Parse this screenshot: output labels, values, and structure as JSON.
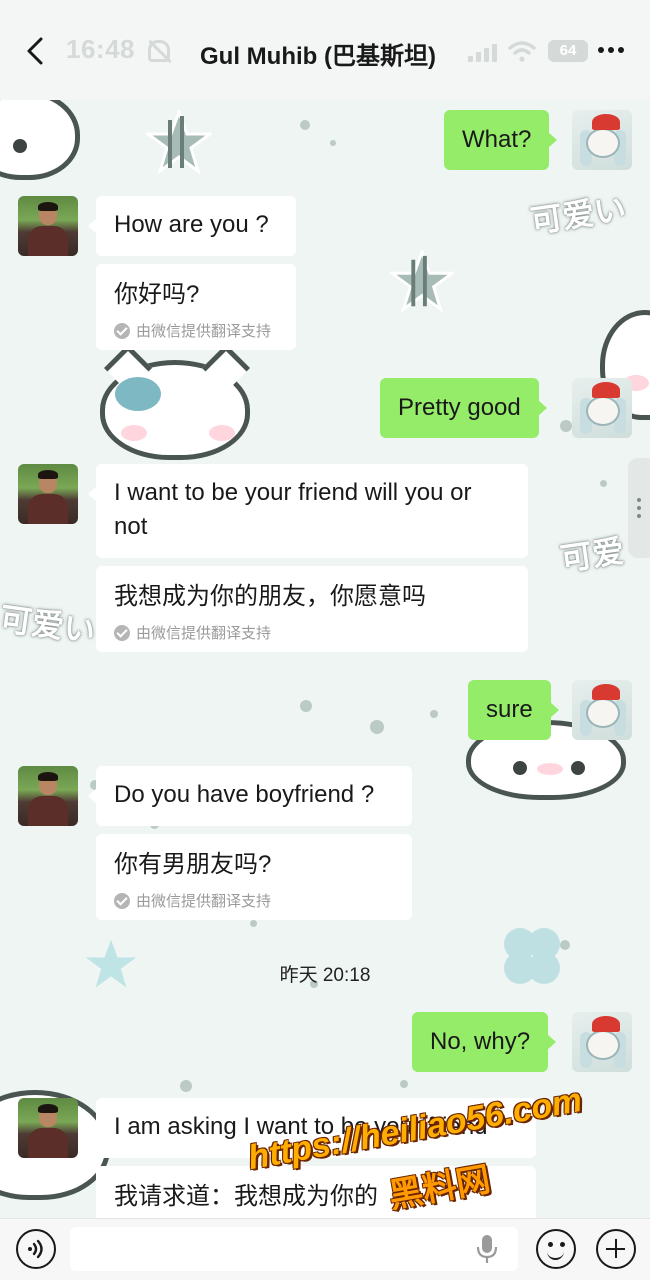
{
  "status_bar": {
    "time": "16:48",
    "battery": "64"
  },
  "header": {
    "title": "Gul Muhib (巴基斯坦)"
  },
  "background": {
    "sticker_text_1": "可爱い",
    "sticker_text_2": "可爱",
    "sticker_text_3": "可爱い"
  },
  "messages": [
    {
      "side": "me",
      "text": "What?"
    },
    {
      "side": "friend",
      "text": "How are you ?",
      "translation": "你好吗?",
      "translation_note": "由微信提供翻译支持"
    },
    {
      "side": "me",
      "text": "Pretty good"
    },
    {
      "side": "friend",
      "text": "I want to be your friend will you or not",
      "translation": "我想成为你的朋友，你愿意吗",
      "translation_note": "由微信提供翻译支持"
    },
    {
      "side": "me",
      "text": "sure"
    },
    {
      "side": "friend",
      "text": "Do you have boyfriend ?",
      "translation": "你有男朋友吗?",
      "translation_note": "由微信提供翻译支持"
    },
    {
      "side": "me",
      "text": "No, why?"
    },
    {
      "side": "friend",
      "text": "I am asking I want to be your friend",
      "translation": "我请求道：我想成为你的"
    }
  ],
  "timestamp": "昨天 20:18",
  "watermark": {
    "url": "https://heiliao56.com",
    "name": "黑料网"
  },
  "icons": [
    "back-icon",
    "muted-bell-icon",
    "signal-icon",
    "wifi-icon",
    "battery-icon",
    "more-icon",
    "voice-icon",
    "mic-icon",
    "emoji-icon",
    "plus-icon",
    "check-icon"
  ]
}
